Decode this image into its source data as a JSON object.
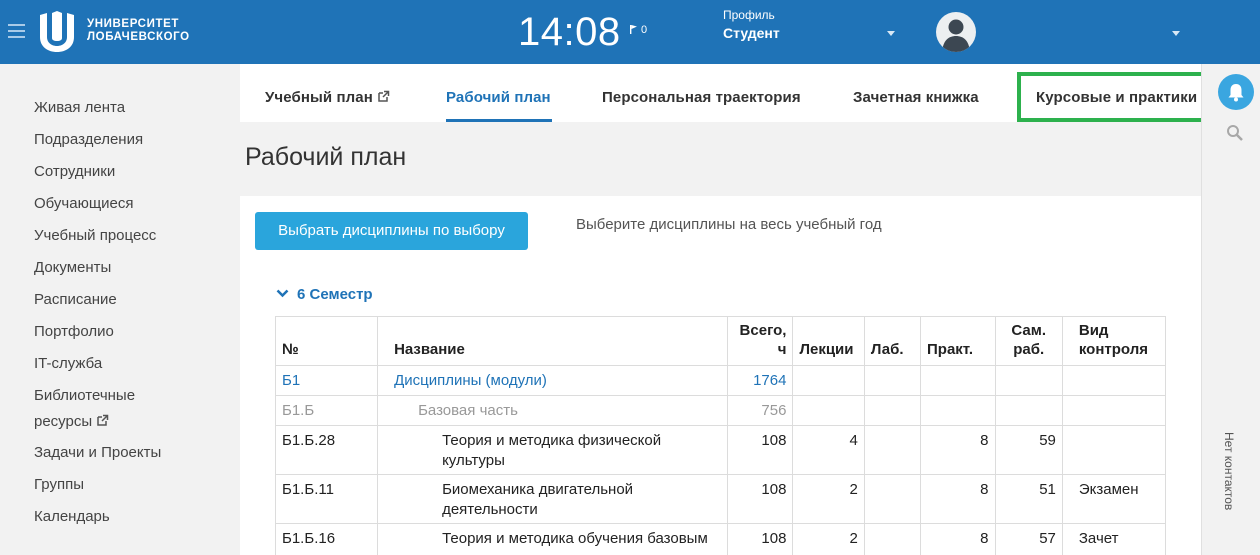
{
  "header": {
    "logo_line1": "УНИВЕРСИТЕТ",
    "logo_line2": "ЛОБАЧЕВСКОГО",
    "time": "14:08",
    "flag_count": "0",
    "profile_label": "Профиль",
    "profile_value": "Студент"
  },
  "sidebar": {
    "items": [
      {
        "label": "Живая лента"
      },
      {
        "label": "Подразделения"
      },
      {
        "label": "Сотрудники"
      },
      {
        "label": "Обучающиеся"
      },
      {
        "label": "Учебный процесс"
      },
      {
        "label": "Документы"
      },
      {
        "label": "Расписание"
      },
      {
        "label": "Портфолио"
      },
      {
        "label": "IT-служба"
      },
      {
        "label": "Библиотечные ресурсы"
      },
      {
        "label": "Задачи и Проекты"
      },
      {
        "label": "Группы"
      },
      {
        "label": "Календарь"
      }
    ]
  },
  "tabs": [
    {
      "label": "Учебный план"
    },
    {
      "label": "Рабочий план"
    },
    {
      "label": "Персональная траектория"
    },
    {
      "label": "Зачетная книжка"
    },
    {
      "label": "Курсовые и практики"
    }
  ],
  "rightrail": {
    "no_contacts": "Нет контактов"
  },
  "main": {
    "title": "Рабочий план",
    "choose_button": "Выбрать дисциплины по выбору",
    "hint": "Выберите дисциплины на весь учебный год",
    "semester": "6 Семестр",
    "table": {
      "headers": {
        "num": "№",
        "name": "Название",
        "total_1": "Всего,",
        "total_2": "ч",
        "lectures": "Лекции",
        "labs": "Лаб.",
        "practice": "Практ.",
        "self_1": "Сам.",
        "self_2": "раб.",
        "control_1": "Вид",
        "control_2": "контроля"
      },
      "rows": [
        {
          "code": "Б1",
          "name": "Дисциплины (модули)",
          "total": "1764",
          "lectures": "",
          "labs": "",
          "practice": "",
          "self": "",
          "control": ""
        },
        {
          "code": "Б1.Б",
          "name": "Базовая часть",
          "total": "756",
          "lectures": "",
          "labs": "",
          "practice": "",
          "self": "",
          "control": ""
        },
        {
          "code": "Б1.Б.28",
          "name": "Теория и методика физической культуры",
          "total": "108",
          "lectures": "4",
          "labs": "",
          "practice": "8",
          "self": "59",
          "control": ""
        },
        {
          "code": "Б1.Б.11",
          "name": "Биомеханика двигательной деятельности",
          "total": "108",
          "lectures": "2",
          "labs": "",
          "practice": "8",
          "self": "51",
          "control": "Экзамен"
        },
        {
          "code": "Б1.Б.16",
          "name": "Теория и методика обучения базовым видам спорта",
          "total": "108",
          "lectures": "2",
          "labs": "",
          "practice": "8",
          "self": "57",
          "control": "Зачет"
        }
      ]
    }
  },
  "colors": {
    "brand": "#1f73b7",
    "button": "#2aa5dc",
    "highlight": "#2db14d"
  }
}
